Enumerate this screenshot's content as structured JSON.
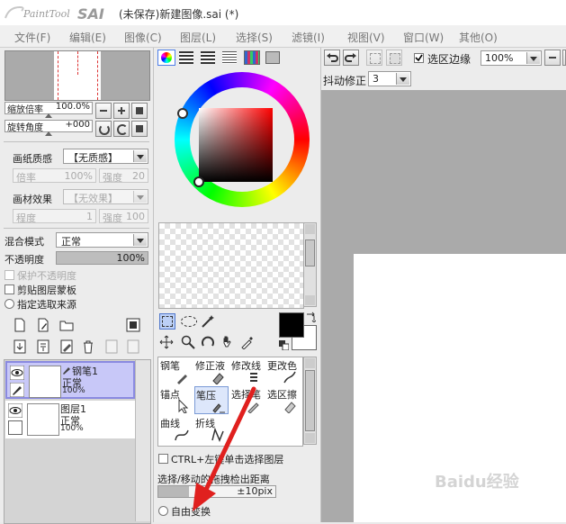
{
  "window": {
    "app_name": "PaintTool SAI",
    "title": "(未保存)新建图像.sai (*)"
  },
  "menu": [
    "文件(F)",
    "编辑(E)",
    "图像(C)",
    "图层(L)",
    "选择(S)",
    "滤镜(I)",
    "视图(V)",
    "窗口(W)",
    "其他(O)"
  ],
  "navigator": {
    "zoom_label": "缩放倍率",
    "zoom_value": "100.0%",
    "rotate_label": "旋转角度",
    "rotate_value": "+000"
  },
  "paper": {
    "texture_label": "画纸质感",
    "texture_value": "【无质感】",
    "scale_label": "倍率",
    "scale_value": "100%",
    "strength_label": "强度",
    "strength_value": "20",
    "effect_label": "画材效果",
    "effect_value": "【无效果】",
    "degree_label": "程度",
    "degree_value": "1",
    "strength2_label": "强度",
    "strength2_value": "100"
  },
  "layer_props": {
    "blend_label": "混合模式",
    "blend_value": "正常",
    "opacity_label": "不透明度",
    "opacity_value": "100%",
    "opacity_fraction": 1.0,
    "preserve_opacity": "保护不透明度",
    "clip_group": "剪贴图层蒙板",
    "selection_source": "指定选取来源"
  },
  "layers": [
    {
      "name": "钢笔1",
      "mode": "正常",
      "opacity": "100%",
      "selected": true
    },
    {
      "name": "图层1",
      "mode": "正常",
      "opacity": "100%",
      "selected": false
    }
  ],
  "tools": [
    {
      "label": "钢笔"
    },
    {
      "label": "修正液"
    },
    {
      "label": "修改线"
    },
    {
      "label": "更改色"
    },
    {
      "label": "锚点"
    },
    {
      "label": "笔压"
    },
    {
      "label": "选择笔"
    },
    {
      "label": "选区擦"
    },
    {
      "label": "曲线"
    },
    {
      "label": "折线"
    }
  ],
  "options": {
    "ctrl_select": "CTRL+左键单击选择图层",
    "distance_label": "选择/移动的拖拽检出距离",
    "distance_value": "±10pix",
    "free_transform": "自由变换"
  },
  "toolbar": {
    "selection_edge": "选区边缘",
    "zoom_value": "100%",
    "stabilizer_label": "抖动修正",
    "stabilizer_value": "3"
  },
  "colors": {
    "primary": "#000000",
    "secondary": "#ffffff",
    "selected_layer": "#c8c8f8",
    "accent_arrow": "#e0201e"
  },
  "watermark": "Baidu经验"
}
